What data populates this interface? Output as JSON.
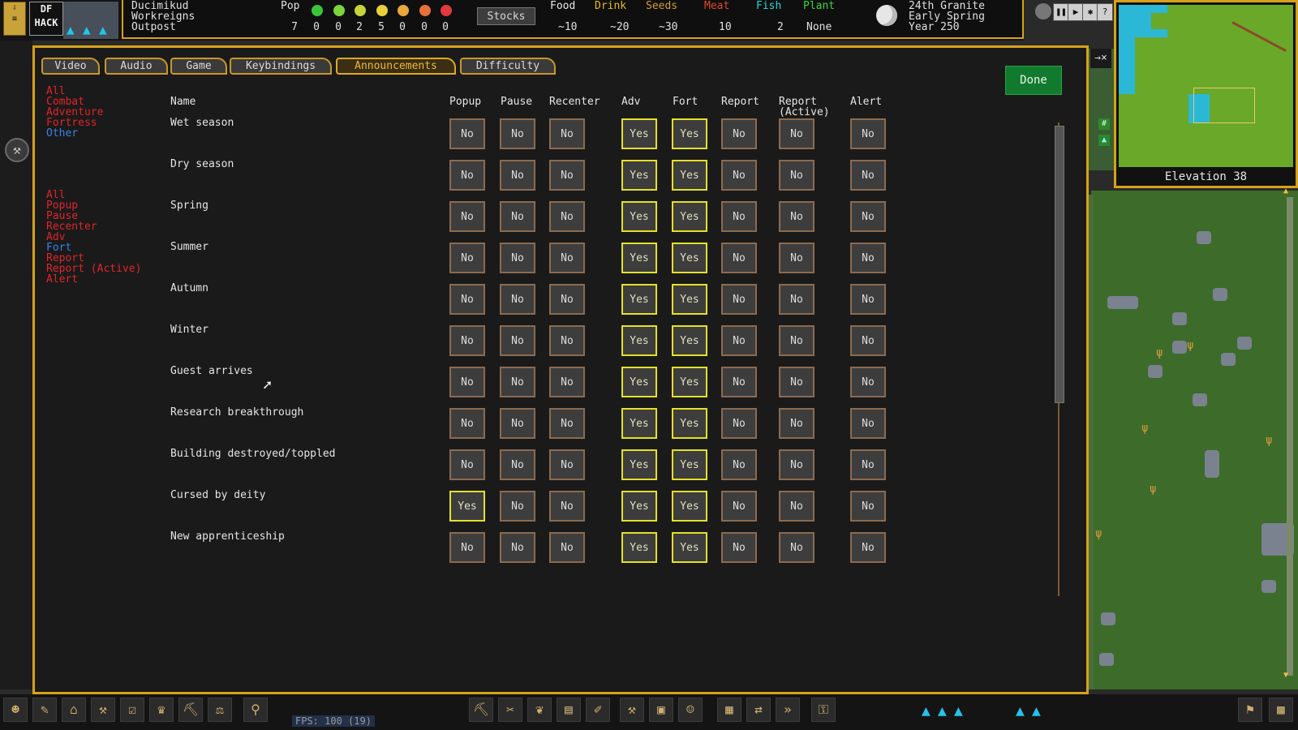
{
  "topbar": {
    "fort_name": "Ducimikud",
    "civ_name": "Workreigns",
    "site_type": "Outpost",
    "pop_label": "Pop",
    "pop_counts": [
      "7",
      "0",
      "0",
      "2",
      "5",
      "0",
      "0",
      "0"
    ],
    "stocks_label": "Stocks",
    "resources": [
      {
        "label": "Food",
        "value": "~10",
        "color": "#e6e6e6"
      },
      {
        "label": "Drink",
        "value": "~20",
        "color": "#e8b820"
      },
      {
        "label": "Seeds",
        "value": "~30",
        "color": "#d29a3a"
      },
      {
        "label": "Meat",
        "value": "10",
        "color": "#e04a2a"
      },
      {
        "label": "Fish",
        "value": "2",
        "color": "#2ad4d4"
      },
      {
        "label": "Plant",
        "value": "None",
        "color": "#3ad43a"
      }
    ],
    "date": {
      "day": "24th Granite",
      "season": "Early Spring",
      "year": "Year 250"
    }
  },
  "minimap": {
    "elevation": "Elevation 38"
  },
  "tabs": [
    {
      "label": "Video",
      "active": false
    },
    {
      "label": "Audio",
      "active": false
    },
    {
      "label": "Game",
      "active": false
    },
    {
      "label": "Keybindings",
      "active": false
    },
    {
      "label": "Announcements",
      "active": true
    },
    {
      "label": "Difficulty",
      "active": false
    }
  ],
  "done_label": "Done",
  "filters_group1": [
    {
      "label": "All",
      "color": "red"
    },
    {
      "label": "Combat",
      "color": "red"
    },
    {
      "label": "Adventure",
      "color": "red"
    },
    {
      "label": "Fortress",
      "color": "red"
    },
    {
      "label": "Other",
      "color": "blue"
    }
  ],
  "filters_group2": [
    {
      "label": "All",
      "color": "red"
    },
    {
      "label": "Popup",
      "color": "red"
    },
    {
      "label": "Pause",
      "color": "red"
    },
    {
      "label": "Recenter",
      "color": "red"
    },
    {
      "label": "Adv",
      "color": "red"
    },
    {
      "label": "Fort",
      "color": "blue"
    },
    {
      "label": "Report",
      "color": "red"
    },
    {
      "label": "Report (Active)",
      "color": "red"
    },
    {
      "label": "Alert",
      "color": "red"
    }
  ],
  "columns": {
    "name": "Name",
    "popup": "Popup",
    "pause": "Pause",
    "recenter": "Recenter",
    "adv": "Adv",
    "fort": "Fort",
    "report": "Report",
    "report_active": "Report\n(Active)",
    "alert": "Alert"
  },
  "rows": [
    {
      "name": "Wet season",
      "values": [
        "No",
        "No",
        "No",
        "Yes",
        "Yes",
        "No",
        "No",
        "No"
      ]
    },
    {
      "name": "Dry season",
      "values": [
        "No",
        "No",
        "No",
        "Yes",
        "Yes",
        "No",
        "No",
        "No"
      ]
    },
    {
      "name": "Spring",
      "values": [
        "No",
        "No",
        "No",
        "Yes",
        "Yes",
        "No",
        "No",
        "No"
      ]
    },
    {
      "name": "Summer",
      "values": [
        "No",
        "No",
        "No",
        "Yes",
        "Yes",
        "No",
        "No",
        "No"
      ]
    },
    {
      "name": "Autumn",
      "values": [
        "No",
        "No",
        "No",
        "Yes",
        "Yes",
        "No",
        "No",
        "No"
      ]
    },
    {
      "name": "Winter",
      "values": [
        "No",
        "No",
        "No",
        "Yes",
        "Yes",
        "No",
        "No",
        "No"
      ]
    },
    {
      "name": "Guest arrives",
      "values": [
        "No",
        "No",
        "No",
        "Yes",
        "Yes",
        "No",
        "No",
        "No"
      ]
    },
    {
      "name": "Research breakthrough",
      "values": [
        "No",
        "No",
        "No",
        "Yes",
        "Yes",
        "No",
        "No",
        "No"
      ]
    },
    {
      "name": "Building destroyed/toppled",
      "values": [
        "No",
        "No",
        "No",
        "Yes",
        "Yes",
        "No",
        "No",
        "No"
      ]
    },
    {
      "name": "Cursed by deity",
      "values": [
        "Yes",
        "No",
        "No",
        "Yes",
        "Yes",
        "No",
        "No",
        "No"
      ]
    },
    {
      "name": "New apprenticeship",
      "values": [
        "No",
        "No",
        "No",
        "Yes",
        "Yes",
        "No",
        "No",
        "No"
      ]
    }
  ],
  "bottombar": {
    "fps": "FPS: 100 (19)"
  },
  "colors": {
    "accent": "#d6a21b",
    "yes_border": "#e4e02a",
    "no_border": "#8b6b50",
    "done_green": "#127a2e",
    "filter_red": "#e0252b",
    "filter_blue": "#3b80e8"
  }
}
